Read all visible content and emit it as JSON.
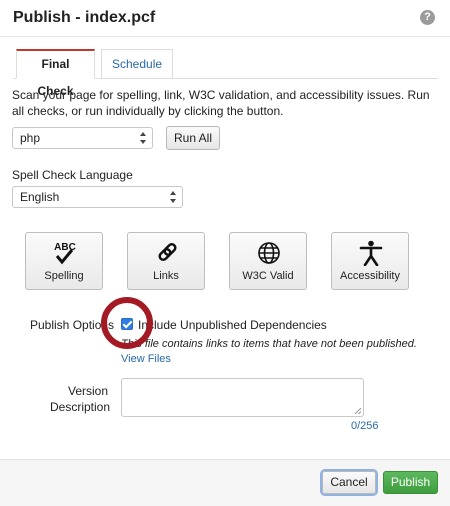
{
  "header": {
    "title": "Publish - index.pcf",
    "help_glyph": "?"
  },
  "tabs": [
    {
      "label": "Final Check",
      "active": true
    },
    {
      "label": "Schedule",
      "active": false
    }
  ],
  "description": "Scan your page for spelling, link, W3C validation, and accessibility issues. Run all checks, or run individually by clicking the button.",
  "target_select": {
    "value": "php"
  },
  "run_all_label": "Run All",
  "spell_lang": {
    "label": "Spell Check Language",
    "value": "English"
  },
  "checks": [
    {
      "label": "Spelling",
      "icon": "spelling-icon",
      "icon_text": "ABC"
    },
    {
      "label": "Links",
      "icon": "link-icon"
    },
    {
      "label": "W3C Valid",
      "icon": "globe-icon"
    },
    {
      "label": "Accessibility",
      "icon": "accessibility-icon"
    }
  ],
  "publish_options": {
    "label": "Publish Options",
    "checkbox_label": "Include Unpublished Dependencies",
    "checked": true,
    "note": "This file contains links to items that have not been published.",
    "view_files": "View Files"
  },
  "version_description": {
    "label_line1": "Version",
    "label_line2": "Description",
    "value": "",
    "counter": "0/256"
  },
  "footer": {
    "cancel": "Cancel",
    "publish": "Publish"
  },
  "colors": {
    "accent_red": "#a31a24",
    "publish_green": "#4cae4c",
    "link_blue": "#2a6aa8",
    "checkbox_blue": "#2f7de1"
  }
}
